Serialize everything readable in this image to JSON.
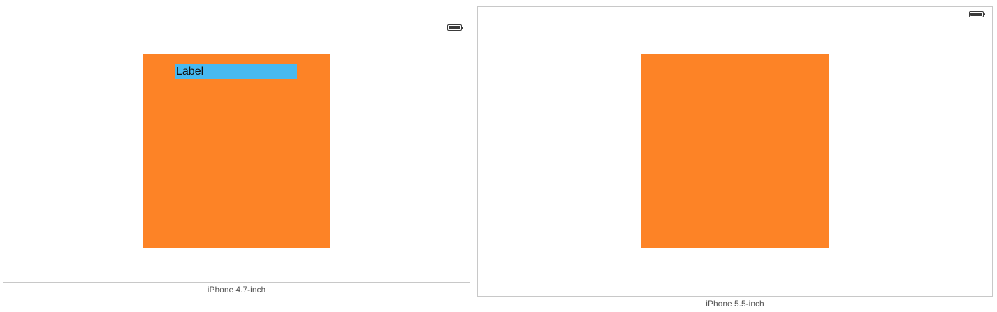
{
  "devices": [
    {
      "caption": "iPhone 4.7-inch",
      "label_text": "Label",
      "view_color": "#fd8326",
      "label_background": "#48b9f0"
    },
    {
      "caption": "iPhone 5.5-inch",
      "view_color": "#fd8326"
    }
  ],
  "icons": {
    "status_bar": "battery-icon"
  }
}
